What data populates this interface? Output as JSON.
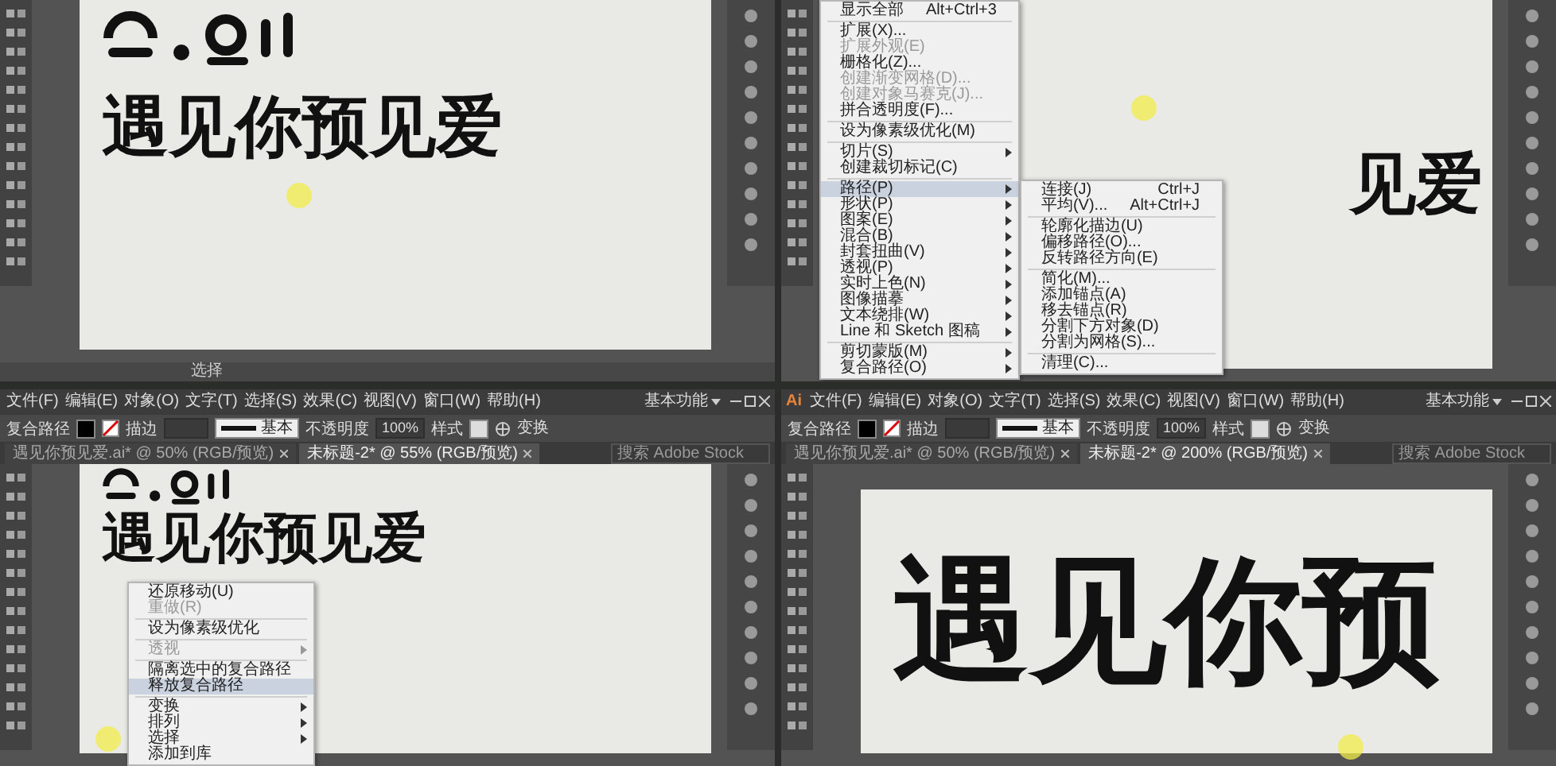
{
  "panels": [
    {
      "artwork": {
        "kind": "normal",
        "text": "遇见你预见爱",
        "logo": true
      },
      "status": {
        "tool": "选择"
      }
    },
    {
      "artwork": {
        "kind": "normal",
        "text": "见爱",
        "logo": false
      },
      "menu": {
        "kind": "dropdown",
        "items": [
          {
            "kind": "item",
            "label": "显示全部",
            "shortcut": "Alt+Ctrl+3",
            "submenu": false,
            "selected": false,
            "disabled": false
          },
          {
            "kind": "separator"
          },
          {
            "kind": "item",
            "label": "扩展(X)...",
            "submenu": false,
            "selected": false,
            "disabled": false
          },
          {
            "kind": "item",
            "label": "扩展外观(E)",
            "submenu": false,
            "selected": false,
            "disabled": true
          },
          {
            "kind": "item",
            "label": "栅格化(Z)...",
            "submenu": false,
            "selected": false,
            "disabled": false
          },
          {
            "kind": "item",
            "label": "创建渐变网格(D)...",
            "submenu": false,
            "selected": false,
            "disabled": true
          },
          {
            "kind": "item",
            "label": "创建对象马赛克(J)...",
            "submenu": false,
            "selected": false,
            "disabled": true
          },
          {
            "kind": "item",
            "label": "拼合透明度(F)...",
            "submenu": false,
            "selected": false,
            "disabled": false
          },
          {
            "kind": "separator"
          },
          {
            "kind": "item",
            "label": "设为像素级优化(M)",
            "submenu": false,
            "selected": false,
            "disabled": false
          },
          {
            "kind": "separator"
          },
          {
            "kind": "item",
            "label": "切片(S)",
            "submenu": true,
            "selected": false,
            "disabled": false
          },
          {
            "kind": "item",
            "label": "创建裁切标记(C)",
            "submenu": false,
            "selected": false,
            "disabled": false
          },
          {
            "kind": "separator"
          },
          {
            "kind": "item",
            "label": "路径(P)",
            "submenu": true,
            "selected": true,
            "disabled": false,
            "children": [
              {
                "kind": "item",
                "label": "连接(J)",
                "shortcut": "Ctrl+J",
                "submenu": false,
                "selected": false,
                "disabled": false
              },
              {
                "kind": "item",
                "label": "平均(V)...",
                "shortcut": "Alt+Ctrl+J",
                "submenu": false,
                "selected": false,
                "disabled": false
              },
              {
                "kind": "separator"
              },
              {
                "kind": "item",
                "label": "轮廓化描边(U)",
                "submenu": false,
                "selected": false,
                "disabled": false
              },
              {
                "kind": "item",
                "label": "偏移路径(O)...",
                "submenu": false,
                "selected": false,
                "disabled": false
              },
              {
                "kind": "item",
                "label": "反转路径方向(E)",
                "submenu": false,
                "selected": false,
                "disabled": false
              },
              {
                "kind": "separator"
              },
              {
                "kind": "item",
                "label": "简化(M)...",
                "submenu": false,
                "selected": false,
                "disabled": false
              },
              {
                "kind": "item",
                "label": "添加锚点(A)",
                "submenu": false,
                "selected": false,
                "disabled": false
              },
              {
                "kind": "item",
                "label": "移去锚点(R)",
                "submenu": false,
                "selected": false,
                "disabled": false
              },
              {
                "kind": "item",
                "label": "分割下方对象(D)",
                "submenu": false,
                "selected": false,
                "disabled": false
              },
              {
                "kind": "item",
                "label": "分割为网格(S)...",
                "submenu": false,
                "selected": false,
                "disabled": false
              },
              {
                "kind": "separator"
              },
              {
                "kind": "item",
                "label": "清理(C)...",
                "submenu": false,
                "selected": false,
                "disabled": false
              }
            ]
          },
          {
            "kind": "item",
            "label": "形状(P)",
            "submenu": true,
            "selected": false,
            "disabled": false
          },
          {
            "kind": "item",
            "label": "图案(E)",
            "submenu": true,
            "selected": false,
            "disabled": false
          },
          {
            "kind": "item",
            "label": "混合(B)",
            "submenu": true,
            "selected": false,
            "disabled": false
          },
          {
            "kind": "item",
            "label": "封套扭曲(V)",
            "submenu": true,
            "selected": false,
            "disabled": false
          },
          {
            "kind": "item",
            "label": "透视(P)",
            "submenu": true,
            "selected": false,
            "disabled": false
          },
          {
            "kind": "item",
            "label": "实时上色(N)",
            "submenu": true,
            "selected": false,
            "disabled": false
          },
          {
            "kind": "item",
            "label": "图像描摹",
            "submenu": true,
            "selected": false,
            "disabled": false
          },
          {
            "kind": "item",
            "label": "文本绕排(W)",
            "submenu": true,
            "selected": false,
            "disabled": false
          },
          {
            "kind": "item",
            "label": "Line 和 Sketch 图稿",
            "submenu": true,
            "selected": false,
            "disabled": false
          },
          {
            "kind": "separator"
          },
          {
            "kind": "item",
            "label": "剪切蒙版(M)",
            "submenu": true,
            "selected": false,
            "disabled": false
          },
          {
            "kind": "item",
            "label": "复合路径(O)",
            "submenu": true,
            "selected": false,
            "disabled": false
          }
        ]
      }
    },
    {
      "header": {
        "menus": [
          "文件(F)",
          "编辑(E)",
          "对象(O)",
          "文字(T)",
          "选择(S)",
          "效果(C)",
          "视图(V)",
          "窗口(W)",
          "帮助(H)"
        ],
        "workspace": "基本功能",
        "search": {
          "placeholder": "搜索 Adobe Stock"
        },
        "control": {
          "selection": "复合路径",
          "stroke_label": "描边",
          "brush": "基本",
          "opacity_label": "不透明度",
          "opacity": "100%",
          "style_label": "样式",
          "transform": "变换"
        },
        "tabs": [
          {
            "label": "遇见你预见爱.ai* @ 50% (RGB/预览)",
            "selected": false
          },
          {
            "label": "未标题-2* @ 55% (RGB/预览)",
            "selected": true
          }
        ]
      },
      "artwork": {
        "kind": "normal",
        "text": "遇见你预见爱",
        "logo": true
      },
      "menu": {
        "kind": "context",
        "items": [
          {
            "kind": "item",
            "label": "还原移动(U)",
            "submenu": false,
            "selected": false,
            "disabled": false
          },
          {
            "kind": "item",
            "label": "重做(R)",
            "submenu": false,
            "selected": false,
            "disabled": true
          },
          {
            "kind": "separator"
          },
          {
            "kind": "item",
            "label": "设为像素级优化",
            "submenu": false,
            "selected": false,
            "disabled": false
          },
          {
            "kind": "separator"
          },
          {
            "kind": "item",
            "label": "透视",
            "submenu": true,
            "selected": false,
            "disabled": true
          },
          {
            "kind": "separator"
          },
          {
            "kind": "item",
            "label": "隔离选中的复合路径",
            "submenu": false,
            "selected": false,
            "disabled": false
          },
          {
            "kind": "item",
            "label": "释放复合路径",
            "submenu": false,
            "selected": true,
            "disabled": false
          },
          {
            "kind": "separator"
          },
          {
            "kind": "item",
            "label": "变换",
            "submenu": true,
            "selected": false,
            "disabled": false
          },
          {
            "kind": "item",
            "label": "排列",
            "submenu": true,
            "selected": false,
            "disabled": false
          },
          {
            "kind": "item",
            "label": "选择",
            "submenu": true,
            "selected": false,
            "disabled": false
          },
          {
            "kind": "item",
            "label": "添加到库",
            "submenu": false,
            "selected": false,
            "disabled": false
          }
        ]
      }
    },
    {
      "header": {
        "app_logo": "Ai",
        "menus": [
          "文件(F)",
          "编辑(E)",
          "对象(O)",
          "文字(T)",
          "选择(S)",
          "效果(C)",
          "视图(V)",
          "窗口(W)",
          "帮助(H)"
        ],
        "workspace": "基本功能",
        "search": {
          "placeholder": "搜索 Adobe Stock"
        },
        "control": {
          "selection": "复合路径",
          "stroke_label": "描边",
          "brush": "基本",
          "opacity_label": "不透明度",
          "opacity": "100%",
          "style_label": "样式",
          "transform": "变换"
        },
        "tabs": [
          {
            "label": "遇见你预见爱.ai* @ 50% (RGB/预览)",
            "selected": false
          },
          {
            "label": "未标题-2* @ 200% (RGB/预览)",
            "selected": true
          }
        ]
      },
      "artwork": {
        "kind": "large",
        "text": "遇见你预",
        "logo": false
      }
    }
  ]
}
